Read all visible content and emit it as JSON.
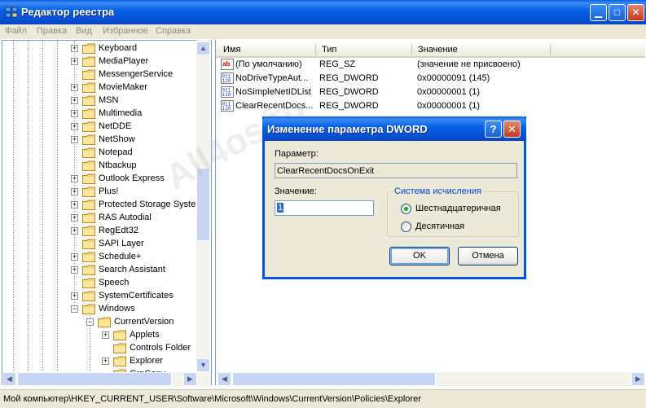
{
  "window": {
    "title": "Редактор реестра"
  },
  "menu": [
    "Файл",
    "Правка",
    "Вид",
    "Избранное",
    "Справка"
  ],
  "tree": {
    "items": [
      {
        "label": "Keyboard",
        "expander": "+"
      },
      {
        "label": "MediaPlayer",
        "expander": "+"
      },
      {
        "label": "MessengerService",
        "expander": ""
      },
      {
        "label": "MovieMaker",
        "expander": "+"
      },
      {
        "label": "MSN",
        "expander": "+"
      },
      {
        "label": "Multimedia",
        "expander": "+"
      },
      {
        "label": "NetDDE",
        "expander": "+"
      },
      {
        "label": "NetShow",
        "expander": "+"
      },
      {
        "label": "Notepad",
        "expander": ""
      },
      {
        "label": "Ntbackup",
        "expander": ""
      },
      {
        "label": "Outlook Express",
        "expander": "+"
      },
      {
        "label": "Plus!",
        "expander": "+"
      },
      {
        "label": "Protected Storage Syste",
        "expander": "+"
      },
      {
        "label": "RAS Autodial",
        "expander": "+"
      },
      {
        "label": "RegEdt32",
        "expander": "+"
      },
      {
        "label": "SAPI Layer",
        "expander": ""
      },
      {
        "label": "Schedule+",
        "expander": "+"
      },
      {
        "label": "Search Assistant",
        "expander": "+"
      },
      {
        "label": "Speech",
        "expander": ""
      },
      {
        "label": "SystemCertificates",
        "expander": "+"
      },
      {
        "label": "Windows",
        "expander": "−"
      },
      {
        "label": "CurrentVersion",
        "expander": "−"
      },
      {
        "label": "Applets",
        "expander": "+"
      },
      {
        "label": "Controls Folder",
        "expander": ""
      },
      {
        "label": "Explorer",
        "expander": "+"
      },
      {
        "label": "GrpConv",
        "expander": ""
      }
    ]
  },
  "list": {
    "columns": [
      "Имя",
      "Тип",
      "Значение"
    ],
    "rows": [
      {
        "icon": "string-value-icon",
        "name": "(По умолчанию)",
        "type": "REG_SZ",
        "value": "(значение не присвоено)"
      },
      {
        "icon": "binary-value-icon",
        "name": "NoDriveTypeAut...",
        "type": "REG_DWORD",
        "value": "0x00000091 (145)"
      },
      {
        "icon": "binary-value-icon",
        "name": "NoSimpleNetIDList",
        "type": "REG_DWORD",
        "value": "0x00000001 (1)"
      },
      {
        "icon": "binary-value-icon",
        "name": "ClearRecentDocs...",
        "type": "REG_DWORD",
        "value": "0x00000001 (1)"
      }
    ]
  },
  "status": {
    "path": "Мой компьютер\\HKEY_CURRENT_USER\\Software\\Microsoft\\Windows\\CurrentVersion\\Policies\\Explorer"
  },
  "dialog": {
    "title": "Изменение параметра DWORD",
    "param_label": "Параметр:",
    "param_value": "ClearRecentDocsOnExit",
    "value_label": "Значение:",
    "value": "1",
    "base_group": "Система исчисления",
    "radio_hex": "Шестнадцатеричная",
    "radio_dec": "Десятичная",
    "selected_base": "hex",
    "ok": "OK",
    "cancel": "Отмена"
  },
  "watermark": "All4os.ru"
}
